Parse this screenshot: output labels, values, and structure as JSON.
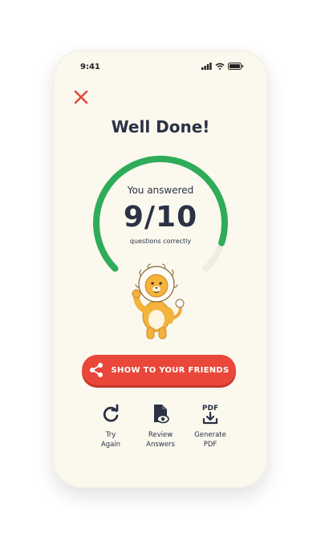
{
  "status_bar": {
    "time": "9:41"
  },
  "header": {
    "close_icon": "close-icon",
    "close_color": "#e34a3b"
  },
  "result": {
    "title": "Well Done!",
    "you_answered": "You answered",
    "score": "9/10",
    "questions_label": "questions correctly",
    "progress_fraction": 0.9,
    "progress_color": "#2eac5a",
    "track_color": "#f0ece0"
  },
  "share_button": {
    "label": "SHOW TO YOUR FRIENDS",
    "icon": "share-icon",
    "color": "#e9473a"
  },
  "actions": [
    {
      "label": "Try\nAgain",
      "icon": "refresh-icon"
    },
    {
      "label": "Review\nAnswers",
      "icon": "document-eye-icon"
    },
    {
      "label": "Generate\nPDF",
      "icon": "pdf-download-icon",
      "icon_text": "PDF"
    }
  ]
}
